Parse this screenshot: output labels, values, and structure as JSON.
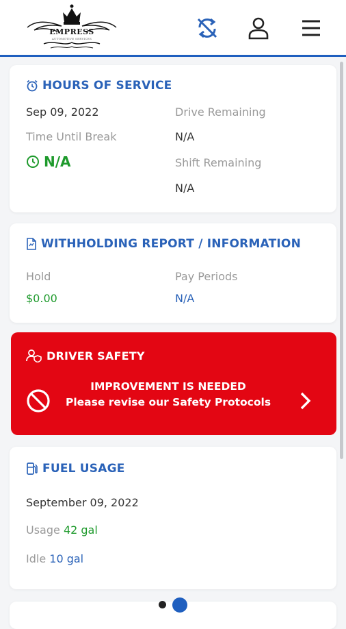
{
  "header": {
    "logo": {
      "name": "EMPRESS",
      "subtitle": "AUTOMOTIVE SERVICES"
    },
    "icons": [
      "sync-off-icon",
      "user-icon",
      "menu-icon"
    ]
  },
  "hos": {
    "title": "HOURS OF SERVICE",
    "date": "Sep 09, 2022",
    "break_label": "Time Until Break",
    "break_value": "N/A",
    "drive_label": "Drive Remaining",
    "drive_value": "N/A",
    "shift_label": "Shift Remaining",
    "shift_value": "N/A"
  },
  "withholding": {
    "title": "WITHHOLDING REPORT / INFORMATION",
    "hold_label": "Hold",
    "hold_value": "$0.00",
    "periods_label": "Pay Periods",
    "periods_value": "N/A"
  },
  "safety": {
    "title": "DRIVER SAFETY",
    "line1": "IMPROVEMENT IS NEEDED",
    "line2": "Please revise our Safety Protocols"
  },
  "fuel": {
    "title": "FUEL USAGE",
    "date": "September 09, 2022",
    "usage_label": "Usage",
    "usage_value": "42 gal",
    "idle_label": "Idle",
    "idle_value": "10 gal"
  },
  "pager": {
    "pages": 2,
    "active": 2
  },
  "colors": {
    "accent": "#2a62b8",
    "success": "#1e9a2c",
    "danger": "#e30613"
  }
}
